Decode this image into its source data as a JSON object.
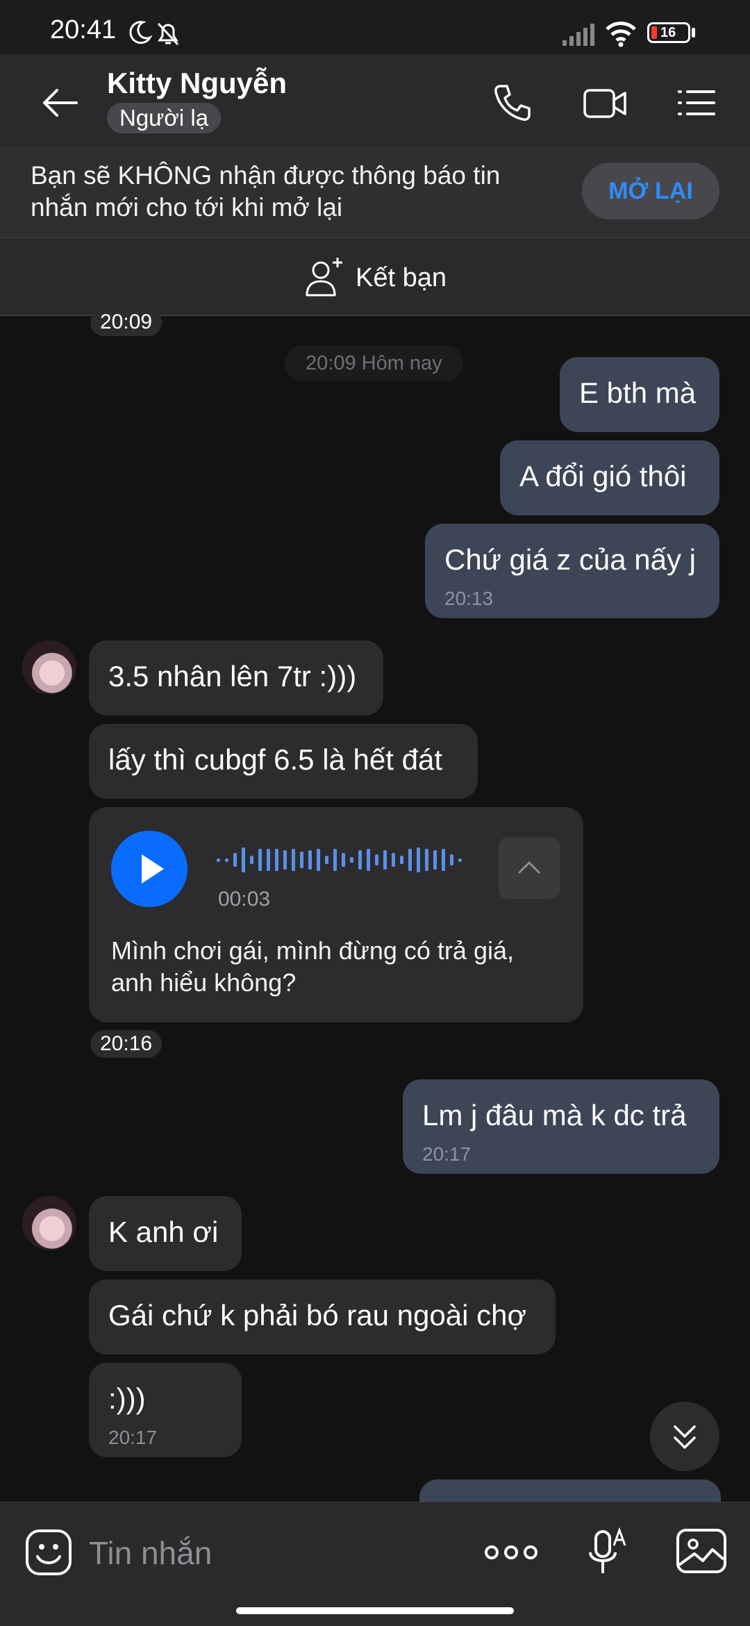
{
  "status_bar": {
    "time": "20:41",
    "battery": "16"
  },
  "header": {
    "contact_name": "Kitty Nguyễn",
    "badge": "Người lạ",
    "icons": [
      "back-arrow-icon",
      "phone-icon",
      "video-camera-icon",
      "list-menu-icon"
    ]
  },
  "notice": {
    "text": "Bạn sẽ KHÔNG nhận được thông báo tin nhắn mới cho tới khi mở lại",
    "button": "MỞ LẠI"
  },
  "add_friend": {
    "label": "Kết bạn"
  },
  "chat": {
    "top_time": "20:09",
    "date_separator": "20:09 Hôm nay",
    "messages": [
      {
        "dir": "out",
        "text": "E bth mà"
      },
      {
        "dir": "out",
        "text": "A đổi gió thôi"
      },
      {
        "dir": "out",
        "text": "Chứ giá z của nấy j",
        "time": "20:13"
      },
      {
        "dir": "in",
        "text": "3.5 nhân lên 7tr :)))"
      },
      {
        "dir": "in",
        "text": "lấy thì cubgf 6.5 là hết đát"
      },
      {
        "dir": "out",
        "text": "Lm j đâu mà k dc trả",
        "time": "20:17"
      },
      {
        "dir": "in",
        "text": "K anh ơi"
      },
      {
        "dir": "in",
        "text": "Gái chứ k phải bó rau ngoài chợ"
      },
      {
        "dir": "in",
        "text": ":)))",
        "time": "20:17"
      }
    ],
    "voice": {
      "duration": "00:03",
      "transcript": "Mình chơi gái, mình đừng có trả giá, anh hiểu không?",
      "time": "20:16"
    }
  },
  "input_bar": {
    "placeholder": "Tin nhắn"
  },
  "colors": {
    "accent": "#0a6cff",
    "outgoing_bubble": "#3d4657",
    "incoming_bubble": "#2c2c2e",
    "link_button": "#2f8cff"
  }
}
